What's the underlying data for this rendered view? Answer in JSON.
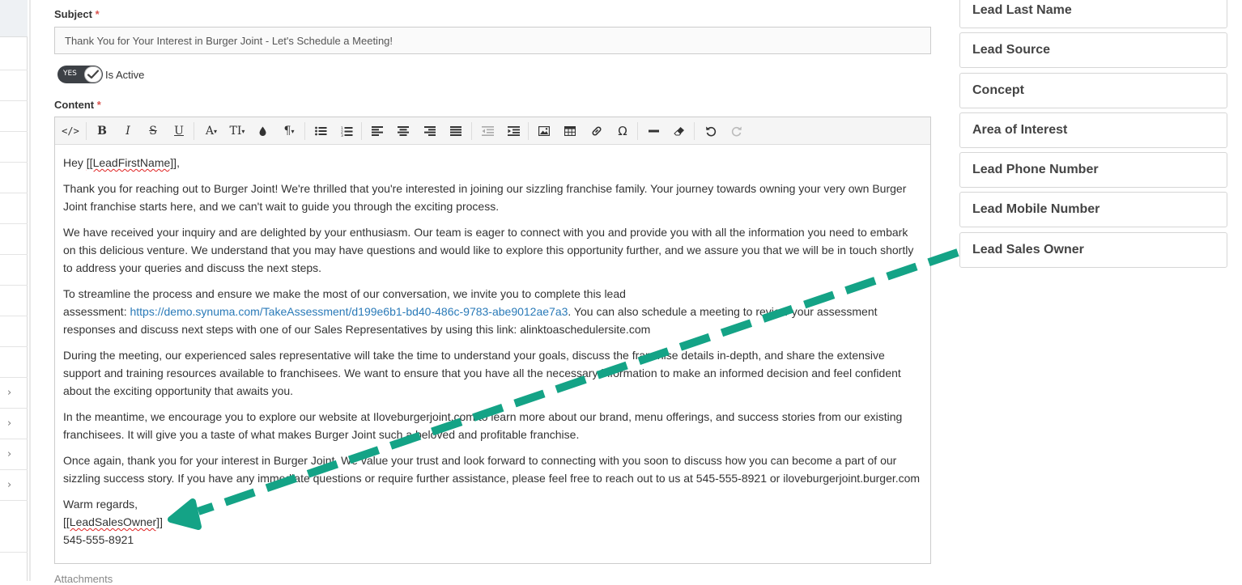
{
  "form": {
    "subject_label": "Subject",
    "required_mark": "*",
    "subject_value": "Thank You for Your Interest in Burger Joint - Let's Schedule a Meeting!",
    "toggle_yes": "YES",
    "toggle_label": "Is Active",
    "content_label": "Content",
    "attachments_label": "Attachments"
  },
  "toolbar": {
    "items": [
      "code-view",
      "bold",
      "italic",
      "strikethrough",
      "underline",
      "font-color",
      "font-size",
      "highlight",
      "paragraph-format",
      "bullet-list",
      "numbered-list",
      "align-left",
      "align-center",
      "align-right",
      "justify",
      "outdent",
      "indent",
      "insert-image",
      "insert-table",
      "insert-link",
      "special-characters",
      "horizontal-line",
      "clear-formatting",
      "undo",
      "redo"
    ],
    "bold_glyph": "B",
    "italic_glyph": "I",
    "strike_glyph": "S",
    "underline_glyph": "U",
    "font_color_glyph": "A",
    "font_size_glyph": "TI",
    "paragraph_glyph": "¶",
    "special_glyph": "Ω",
    "dropdown_glyph": "▾"
  },
  "email": {
    "greeting_prefix": "Hey ",
    "greeting_token": "[[LeadFirstName]]",
    "greeting_suffix": ",",
    "p1": "Thank you for reaching out to Burger Joint! We're thrilled that you're interested in joining our sizzling franchise family. Your journey towards owning your very own Burger Joint franchise starts here, and we can't wait to guide you through the exciting process.",
    "p2": "We have received your inquiry and are delighted by your enthusiasm. Our team is eager to connect with you and provide you with all the information you need to embark on this delicious venture. We understand that you may have questions and would like to explore this opportunity further, and we assure you that we will be in touch shortly to address your queries and discuss the next steps.",
    "p3_line1": "To streamline the process and ensure we make the most of our conversation, we invite you to complete this lead",
    "p3_prefix": "assessment: ",
    "p3_link": "https://demo.synuma.com/TakeAssessment/d199e6b1-bd40-486c-9783-abe9012ae7a3",
    "p3_suffix": ". You can also schedule a meeting to review your assessment responses and discuss next steps with one of our Sales Representatives by using this link: alinktoaschedulersite.com",
    "p4": "During the meeting, our experienced sales representative will take the time to understand your goals, discuss the franchise details in-depth, and share the extensive support and training resources available to franchisees. We want to ensure that you have all the necessary information to make an informed decision and feel confident about the exciting opportunity that awaits you.",
    "p5": "In the meantime, we encourage you to explore our website at Iloveburgerjoint.com to learn more about our brand, menu offerings, and success stories from our existing franchisees. It will give you a taste of what makes Burger Joint such a beloved and profitable franchise.",
    "p6": "Once again, thank you for your interest in Burger Joint. We value your trust and look forward to connecting with you soon to discuss how you can become a part of our sizzling success story. If you have any immediate questions or require further assistance, please feel free to reach out to us at 545-555-8921 or iloveburgerjoint.burger.com",
    "closing": "Warm regards,",
    "signature_token": "[[LeadSalesOwner]]",
    "phone": "545-555-8921"
  },
  "merge_fields": [
    "Lead Last Name",
    "Lead Source",
    "Concept",
    "Area of Interest",
    "Lead Phone Number",
    "Lead Mobile Number",
    "Lead Sales Owner"
  ],
  "colors": {
    "arrow": "#14a386",
    "link": "#2a7ab8",
    "required": "#d9534f",
    "toggle_bg": "#3d4146"
  }
}
